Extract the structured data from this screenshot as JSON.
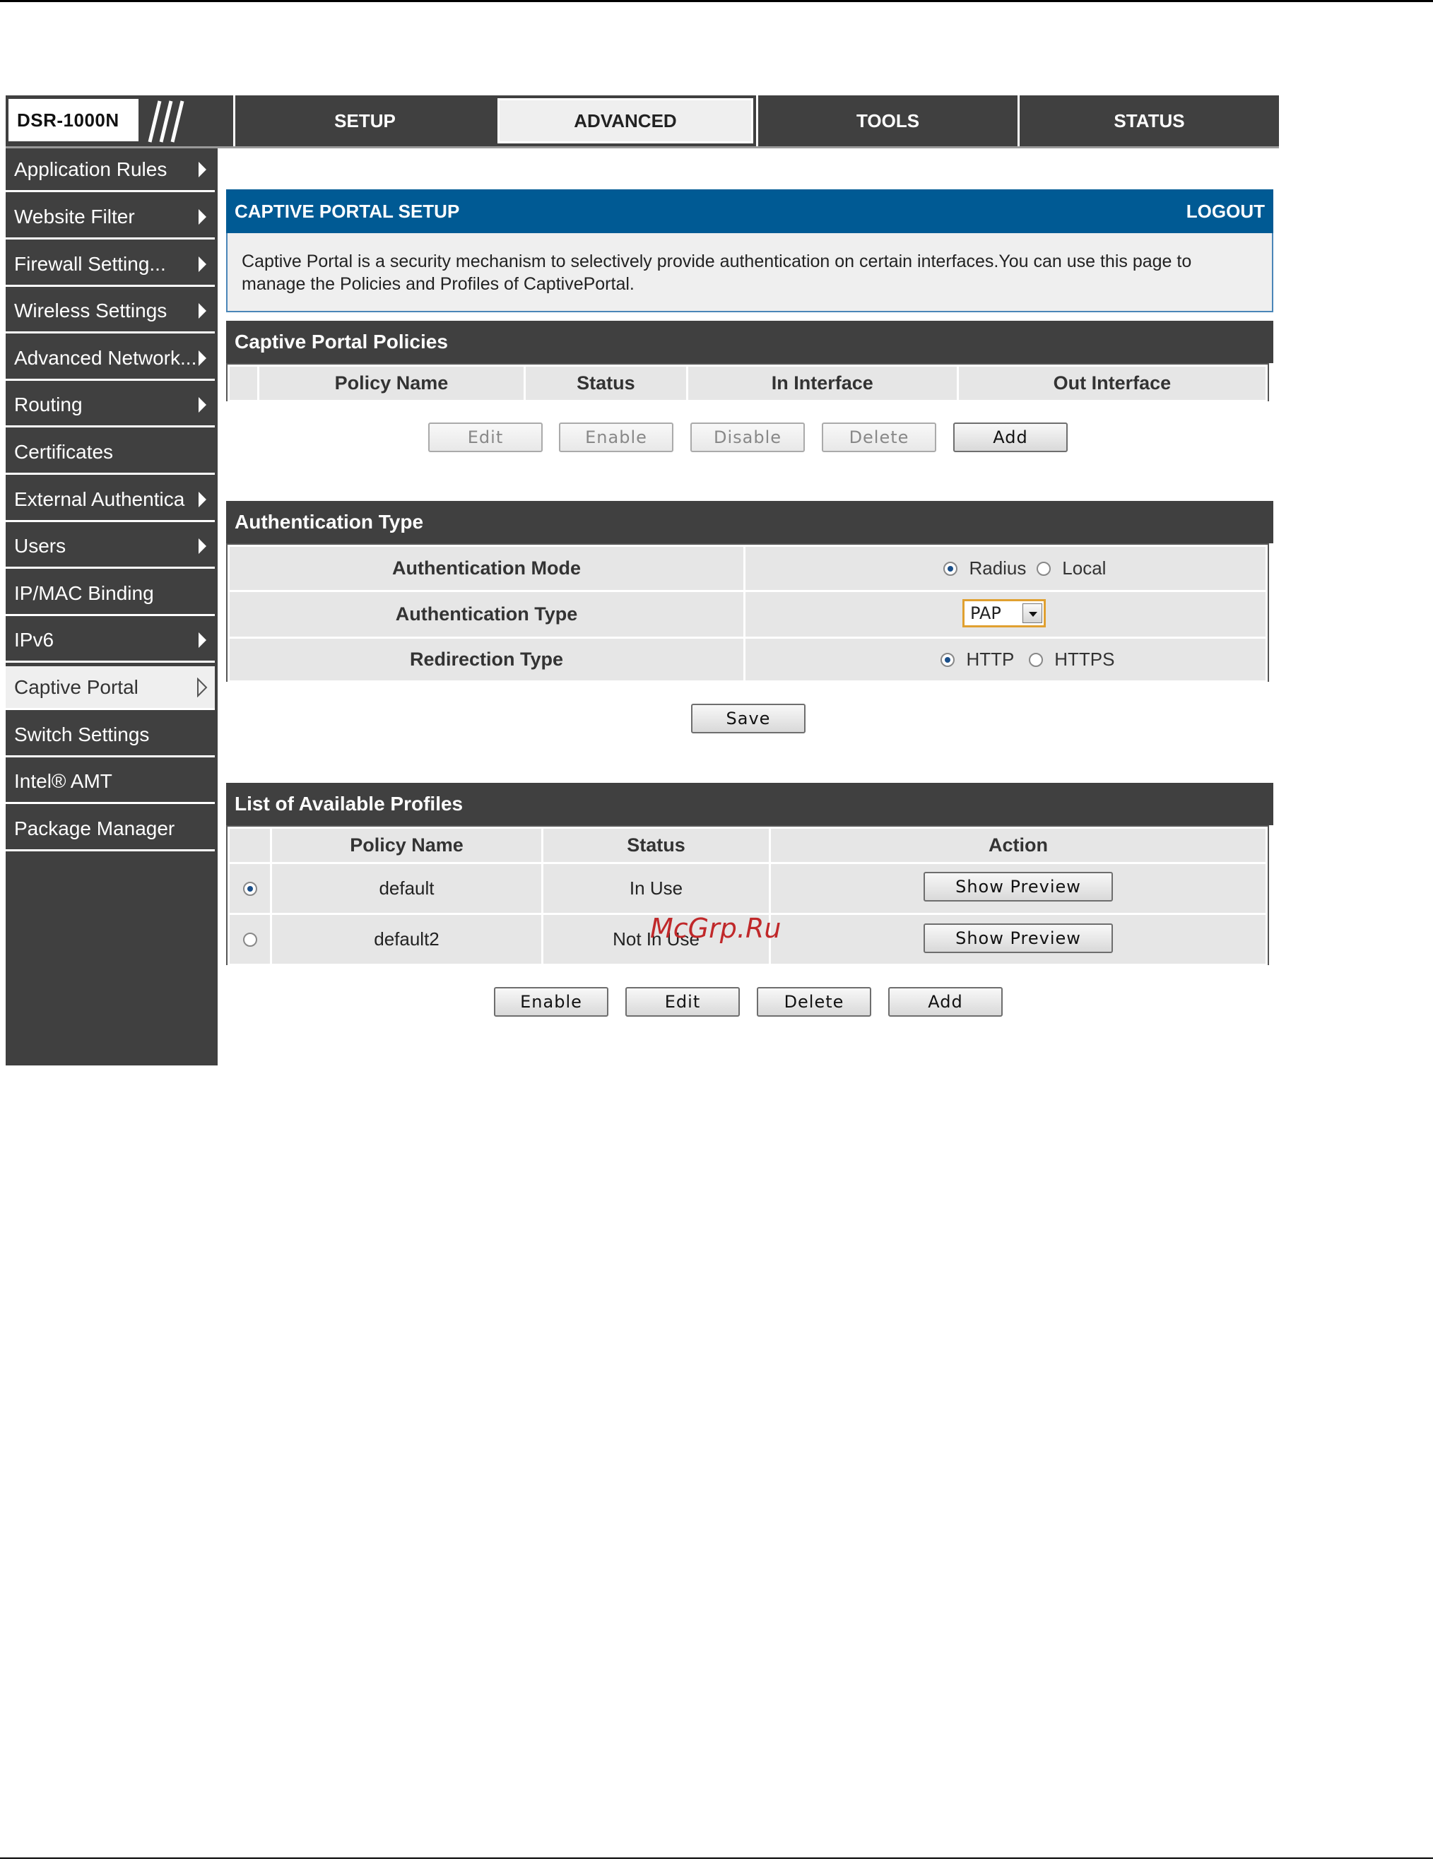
{
  "logo": {
    "text": "DSR-1000N"
  },
  "nav": {
    "tabs": [
      {
        "label": "SETUP"
      },
      {
        "label": "ADVANCED"
      },
      {
        "label": "TOOLS"
      },
      {
        "label": "STATUS"
      }
    ],
    "active": "ADVANCED"
  },
  "sidebar": {
    "items": [
      {
        "label": "Application Rules"
      },
      {
        "label": "Website Filter"
      },
      {
        "label": "Firewall Setting..."
      },
      {
        "label": "Wireless Settings"
      },
      {
        "label": "Advanced Network..."
      },
      {
        "label": "Routing"
      },
      {
        "label": "Certificates"
      },
      {
        "label": "External Authentica"
      },
      {
        "label": "Users"
      },
      {
        "label": "IP/MAC Binding"
      },
      {
        "label": "IPv6"
      },
      {
        "label": "Captive Portal"
      },
      {
        "label": "Switch Settings"
      },
      {
        "label": "Intel® AMT"
      },
      {
        "label": "Package Manager"
      }
    ],
    "active": "Captive Portal"
  },
  "captive_portal": {
    "title": "CAPTIVE PORTAL SETUP",
    "logout": "LOGOUT",
    "description": "Captive Portal is a security mechanism to selectively provide authentication on certain interfaces.You can use this page to manage the Policies and Profiles of CaptivePortal."
  },
  "policies": {
    "title": "Captive Portal Policies",
    "columns": [
      "Policy Name",
      "Status",
      "In Interface",
      "Out Interface"
    ],
    "buttons": {
      "edit": "Edit",
      "enable": "Enable",
      "disable": "Disable",
      "delete": "Delete",
      "add": "Add"
    }
  },
  "auth": {
    "title": "Authentication Type",
    "mode_label": "Authentication Mode",
    "mode_options": {
      "radius": "Radius",
      "local": "Local"
    },
    "mode_selected": "Radius",
    "type_label": "Authentication Type",
    "type_value": "PAP",
    "redirect_label": "Redirection Type",
    "redirect_options": {
      "http": "HTTP",
      "https": "HTTPS"
    },
    "redirect_selected": "HTTP",
    "save": "Save"
  },
  "profiles": {
    "title": "List of Available Profiles",
    "columns": [
      "Policy Name",
      "Status",
      "Action"
    ],
    "rows": [
      {
        "name": "default",
        "status": "In Use",
        "action": "Show Preview",
        "selected": true
      },
      {
        "name": "default2",
        "status": "Not In Use",
        "action": "Show Preview",
        "selected": false
      }
    ],
    "buttons": {
      "enable": "Enable",
      "edit": "Edit",
      "delete": "Delete",
      "add": "Add"
    }
  },
  "watermark": "McGrp.Ru"
}
